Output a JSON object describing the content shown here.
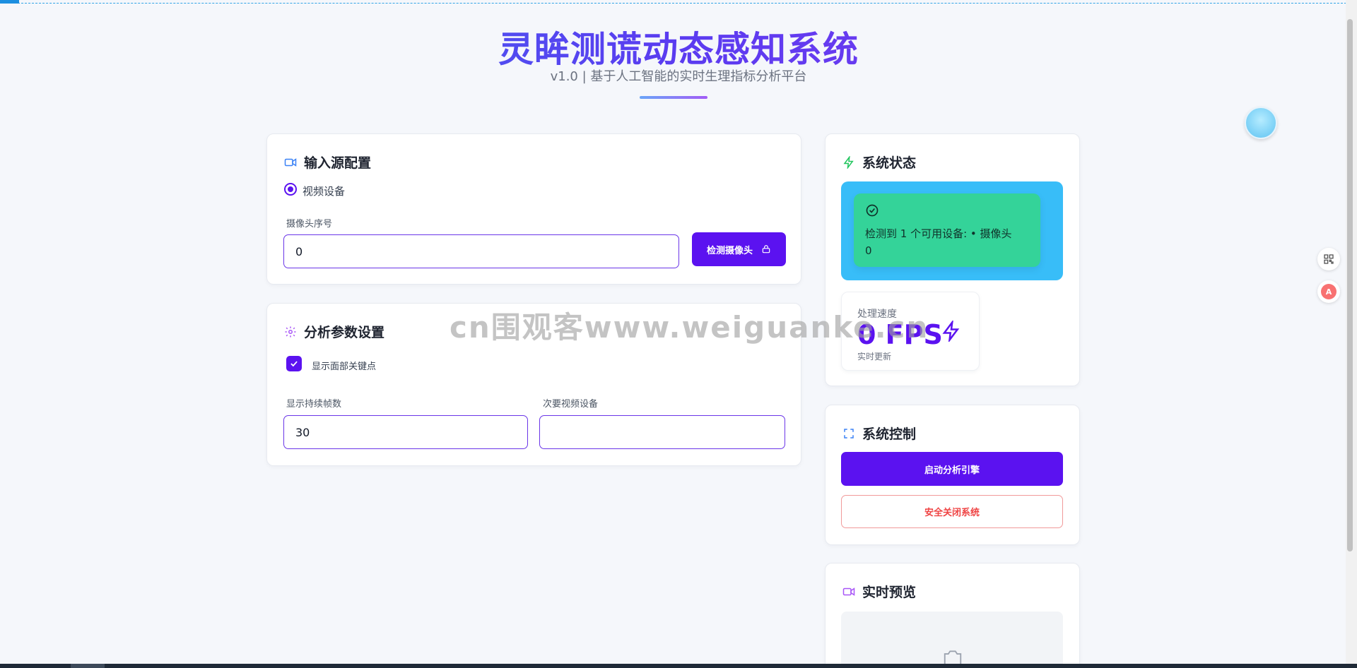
{
  "header": {
    "title": "灵眸测谎动态感知系统",
    "subtitle": "v1.0 | 基于人工智能的实时生理指标分析平台"
  },
  "input_source": {
    "title": "输入源配置",
    "radio_label": "视频设备",
    "camera_index_label": "摄像头序号",
    "camera_index_value": "0",
    "detect_button": "检测摄像头"
  },
  "analysis": {
    "title": "分析参数设置",
    "checkbox_label": "显示面部关键点",
    "checkbox_checked": true,
    "frames_label": "显示持续帧数",
    "frames_value": "30",
    "secondary_label": "次要视频设备",
    "secondary_value": ""
  },
  "system_status": {
    "title": "系统状态",
    "message": "检测到 1 个可用设备: • 摄像头 0",
    "speed_label": "处理速度",
    "fps_value": "0 FPS",
    "speed_sub": "实时更新"
  },
  "system_control": {
    "title": "系统控制",
    "start_button": "启动分析引擎",
    "shutdown_button": "安全关闭系统"
  },
  "preview": {
    "title": "实时预览"
  },
  "watermark": "cn围观客www.weiguanke.cn",
  "colors": {
    "primary": "#5b12f0",
    "status_outer": "#38bdf8",
    "status_inner": "#34d399",
    "danger": "#ef4444"
  }
}
